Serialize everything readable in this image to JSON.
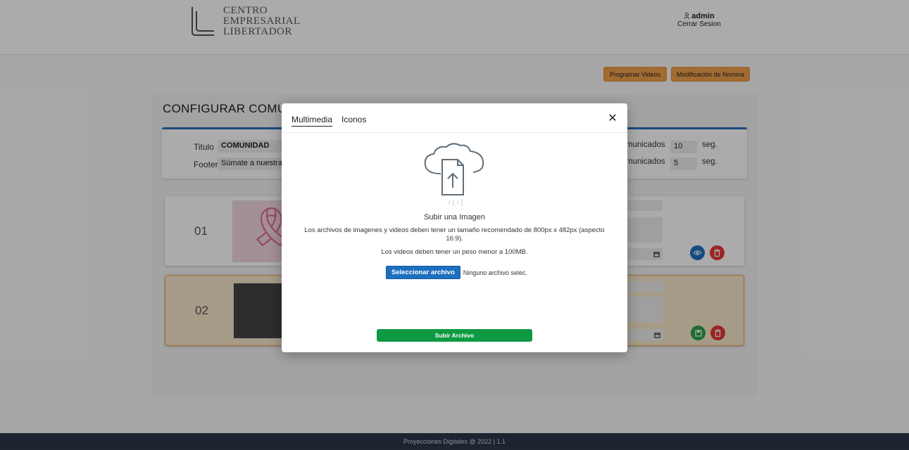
{
  "header": {
    "logo_lines": [
      "CENTRO",
      "EMPRESARIAL",
      "LIBERTADOR"
    ],
    "user_name": "admin",
    "logout_label": "Cerrar Sesion"
  },
  "toolbar": {
    "program_videos_label": "Programar Videos",
    "payroll_label": "Modificación de Nomina"
  },
  "page": {
    "title": "CONFIGURAR COMUNIC",
    "form": {
      "title_label": "Titulo",
      "title_value": "COMUNIDAD",
      "footer_label": "Footer",
      "footer_value": "Súmate a nuestra",
      "comm_label_1": "municados",
      "comm_value_1": "10",
      "comm_unit_1": "seg.",
      "comm_label_2": "municados",
      "comm_value_2": "5",
      "comm_unit_2": "seg."
    },
    "items": [
      {
        "number": "01"
      },
      {
        "number": "02"
      }
    ]
  },
  "modal": {
    "tabs": [
      "Multimedia",
      "Iconos"
    ],
    "active_tab": "Multimedia",
    "upload_title": "Subir una Imagen",
    "size_note": "Los archivos de imagenes y videos deben tener un tamaño recomendado de 800px x 482px (aspecto 16:9).",
    "weight_note": "Los videos deben tener un peso menor a 100MB.",
    "select_file_label": "Seleccionar archivo",
    "file_status": "Ninguno archivo selec.",
    "submit_label": "Subir Archivo",
    "icons": {
      "close": "close-icon",
      "upload": "cloud-upload-icon"
    }
  },
  "footer": {
    "text": "Proyecciones Digitales @ 2022 | 1.1"
  },
  "colors": {
    "accent_blue": "#1e6fbf",
    "orange": "#f0a04b",
    "green": "#0e9a43",
    "red": "#e53935",
    "footer_bg": "#2b3846"
  }
}
